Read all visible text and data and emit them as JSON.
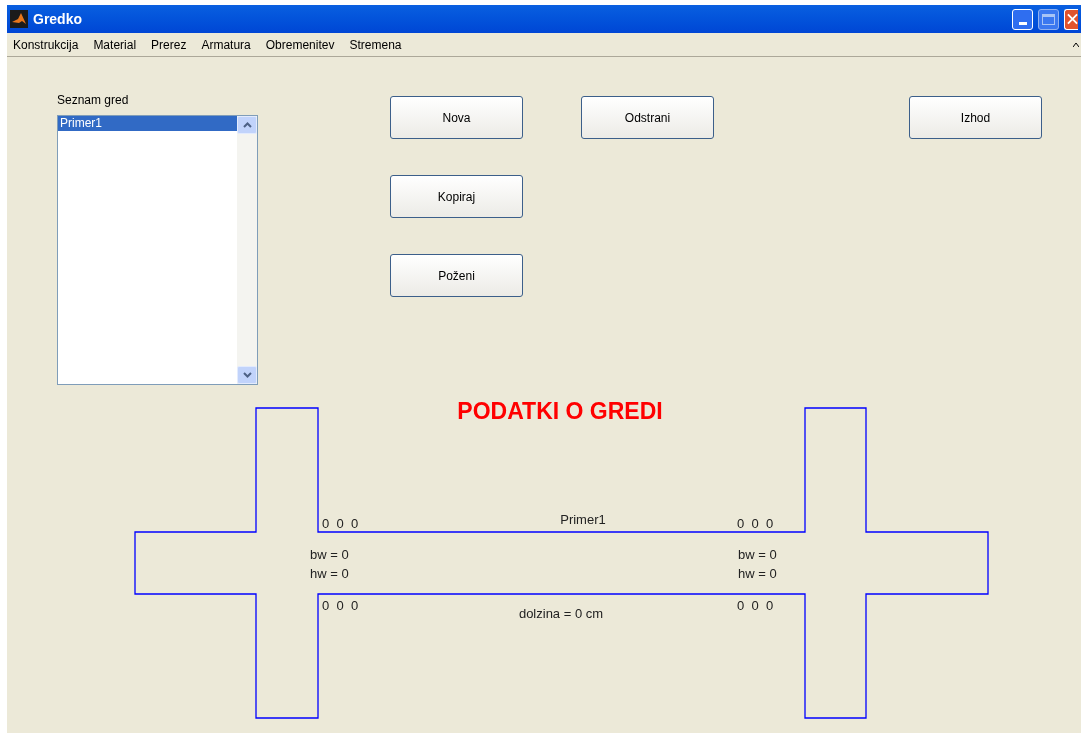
{
  "window": {
    "title": "Gredko"
  },
  "menu": [
    "Konstrukcija",
    "Material",
    "Prerez",
    "Armatura",
    "Obremenitev",
    "Stremena"
  ],
  "beam_list": {
    "label": "Seznam gred",
    "items": [
      {
        "text": "Primer1",
        "selected": true
      }
    ]
  },
  "button_column": [
    "Nova",
    "Kopiraj",
    "Poženi"
  ],
  "right_buttons": [
    "Odstrani",
    "Izhod"
  ],
  "beam": {
    "title": "PODATKI O GREDI",
    "name": "Primer1",
    "top_left": "0  0  0",
    "top_right": "0  0  0",
    "bw_left": "bw = 0",
    "hw_left": "hw = 0",
    "bw_right": "bw = 0",
    "hw_right": "hw = 0",
    "bottom_left": "0  0  0",
    "bottom_right": "0  0  0",
    "length": "dolzina = 0 cm"
  }
}
